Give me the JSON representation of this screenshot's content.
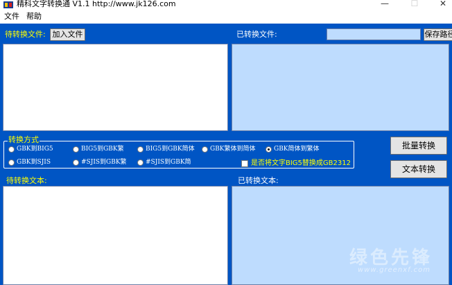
{
  "window": {
    "title": "精科文字转换通 V1.1  http://www.jk126.com",
    "minimize_glyph": "—",
    "maximize_glyph": "☐",
    "close_glyph": "✕"
  },
  "menu": {
    "items": [
      "文件",
      "帮助"
    ]
  },
  "files": {
    "pending_label": "待转换文件:",
    "add_button": "加入文件",
    "converted_label": "已转换文件:",
    "save_path_value": "",
    "save_path_button": "保存路径"
  },
  "conversion": {
    "group_title": "转换方式",
    "options": [
      {
        "label": "GBK到BIG5",
        "checked": false
      },
      {
        "label": "BIG5到GBK繁",
        "checked": false
      },
      {
        "label": "BIG5到GBK简体",
        "checked": false
      },
      {
        "label": "GBK繁体到简体",
        "checked": false
      },
      {
        "label": "GBK简体到繁体",
        "checked": true
      },
      {
        "label": "GBK到SJIS",
        "checked": false
      },
      {
        "label": "#SJIS到GBK繁",
        "checked": false
      },
      {
        "label": "#SJIS到GBK简",
        "checked": false
      }
    ],
    "replace_checkbox": {
      "label": "是否将文字BIG5替换成GB2312",
      "checked": false
    }
  },
  "actions": {
    "batch_convert": "批量转换",
    "text_convert": "文本转换"
  },
  "text": {
    "pending_label": "待转换文本:",
    "converted_label": "已转换文本:"
  },
  "watermark": {
    "text": "绿色先锋",
    "url": "www.greenxf.com"
  },
  "colors": {
    "background": "#0055c4",
    "output_pane": "#bedcfe",
    "label_yellow": "#ffff00"
  }
}
